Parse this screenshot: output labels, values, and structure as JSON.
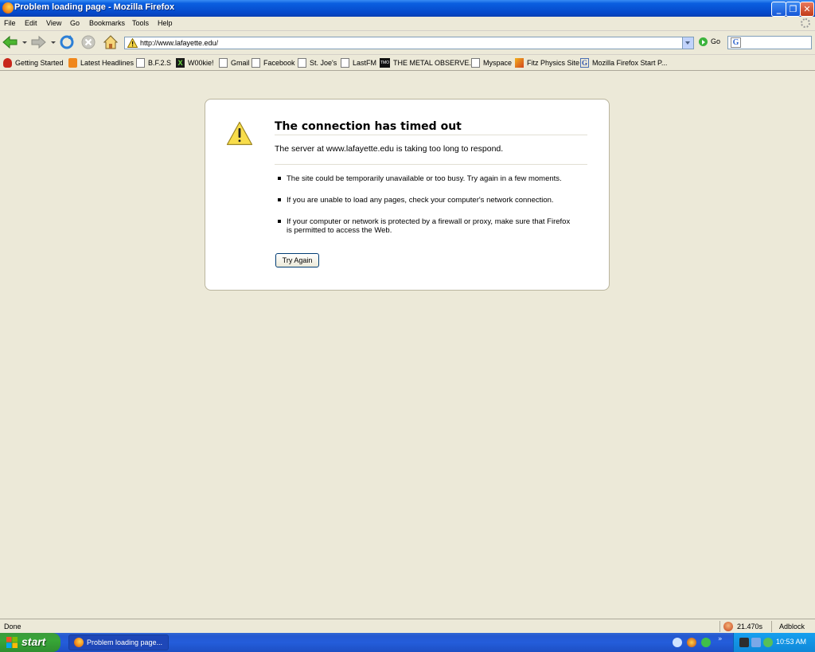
{
  "window": {
    "title": "Problem loading page - Mozilla Firefox",
    "minimize": "_",
    "maximize": "❐",
    "close": "✕"
  },
  "menu": [
    "File",
    "Edit",
    "View",
    "Go",
    "Bookmarks",
    "Tools",
    "Help"
  ],
  "nav": {
    "url": "http://www.lafayette.edu/",
    "go_label": "Go",
    "search_value": ""
  },
  "bookmarks": [
    {
      "label": "Getting Started",
      "icon": "red-hat-icon"
    },
    {
      "label": "Latest Headlines",
      "icon": "rss-icon"
    },
    {
      "label": "B.F.2.S",
      "icon": "page-icon"
    },
    {
      "label": "W00kie!",
      "icon": "x-icon"
    },
    {
      "label": "Gmail",
      "icon": "page-icon"
    },
    {
      "label": "Facebook",
      "icon": "page-icon"
    },
    {
      "label": "St. Joe's",
      "icon": "page-icon"
    },
    {
      "label": "LastFM",
      "icon": "page-icon"
    },
    {
      "label": "THE METAL OBSERVE...",
      "icon": "tmo-icon"
    },
    {
      "label": "Myspace",
      "icon": "page-icon"
    },
    {
      "label": "Fitz Physics Site",
      "icon": "fitz-icon"
    },
    {
      "label": "Mozilla Firefox Start P...",
      "icon": "google-icon"
    }
  ],
  "error": {
    "title": "The connection has timed out",
    "description": "The server at www.lafayette.edu is taking too long to respond.",
    "bullets": [
      "The site could be temporarily unavailable or too busy. Try again in a few moments.",
      "If you are unable to load any pages, check your computer's network connection.",
      "If your computer or network is protected by a firewall or proxy, make sure that Firefox is permitted to access the Web."
    ],
    "button": "Try Again"
  },
  "status": {
    "text": "Done",
    "timer": "21.470s",
    "adblock": "Adblock"
  },
  "taskbar": {
    "start_label": "start",
    "task_label": "Problem loading page...",
    "tray_chevron": "»",
    "clock": "10:53 AM"
  },
  "colors": {
    "titlebar": "#0548c9",
    "taskbar": "#245ddb",
    "start": "#37a637",
    "background": "#ece9d8"
  }
}
